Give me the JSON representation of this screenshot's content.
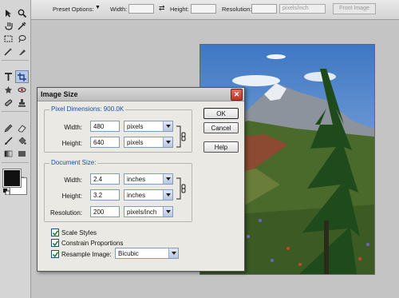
{
  "options_bar": {
    "preset_label": "Preset Options:",
    "width_label": "Width:",
    "height_label": "Height:",
    "resolution_label": "Resolution:",
    "resolution_unit": "pixels/inch",
    "front_image_label": "Front Image",
    "swap_symbol": "⇄"
  },
  "dialog": {
    "title": "Image Size",
    "close_symbol": "✕",
    "pixel_dimensions_title": "Pixel Dimensions: 900.0K",
    "width_label": "Width:",
    "height_label": "Height:",
    "pixel_width_value": "480",
    "pixel_width_unit": "pixels",
    "pixel_height_value": "640",
    "pixel_height_unit": "pixels",
    "document_size_title": "Document Size:",
    "doc_width_value": "2.4",
    "doc_width_unit": "inches",
    "doc_height_value": "3.2",
    "doc_height_unit": "inches",
    "resolution_label": "Resolution:",
    "resolution_value": "200",
    "resolution_unit": "pixels/inch",
    "ok_label": "OK",
    "cancel_label": "Cancel",
    "help_label": "Help",
    "scale_styles_label": "Scale Styles",
    "constrain_label": "Constrain Proportions",
    "resample_label": "Resample Image:",
    "resample_value": "Bicubic"
  }
}
